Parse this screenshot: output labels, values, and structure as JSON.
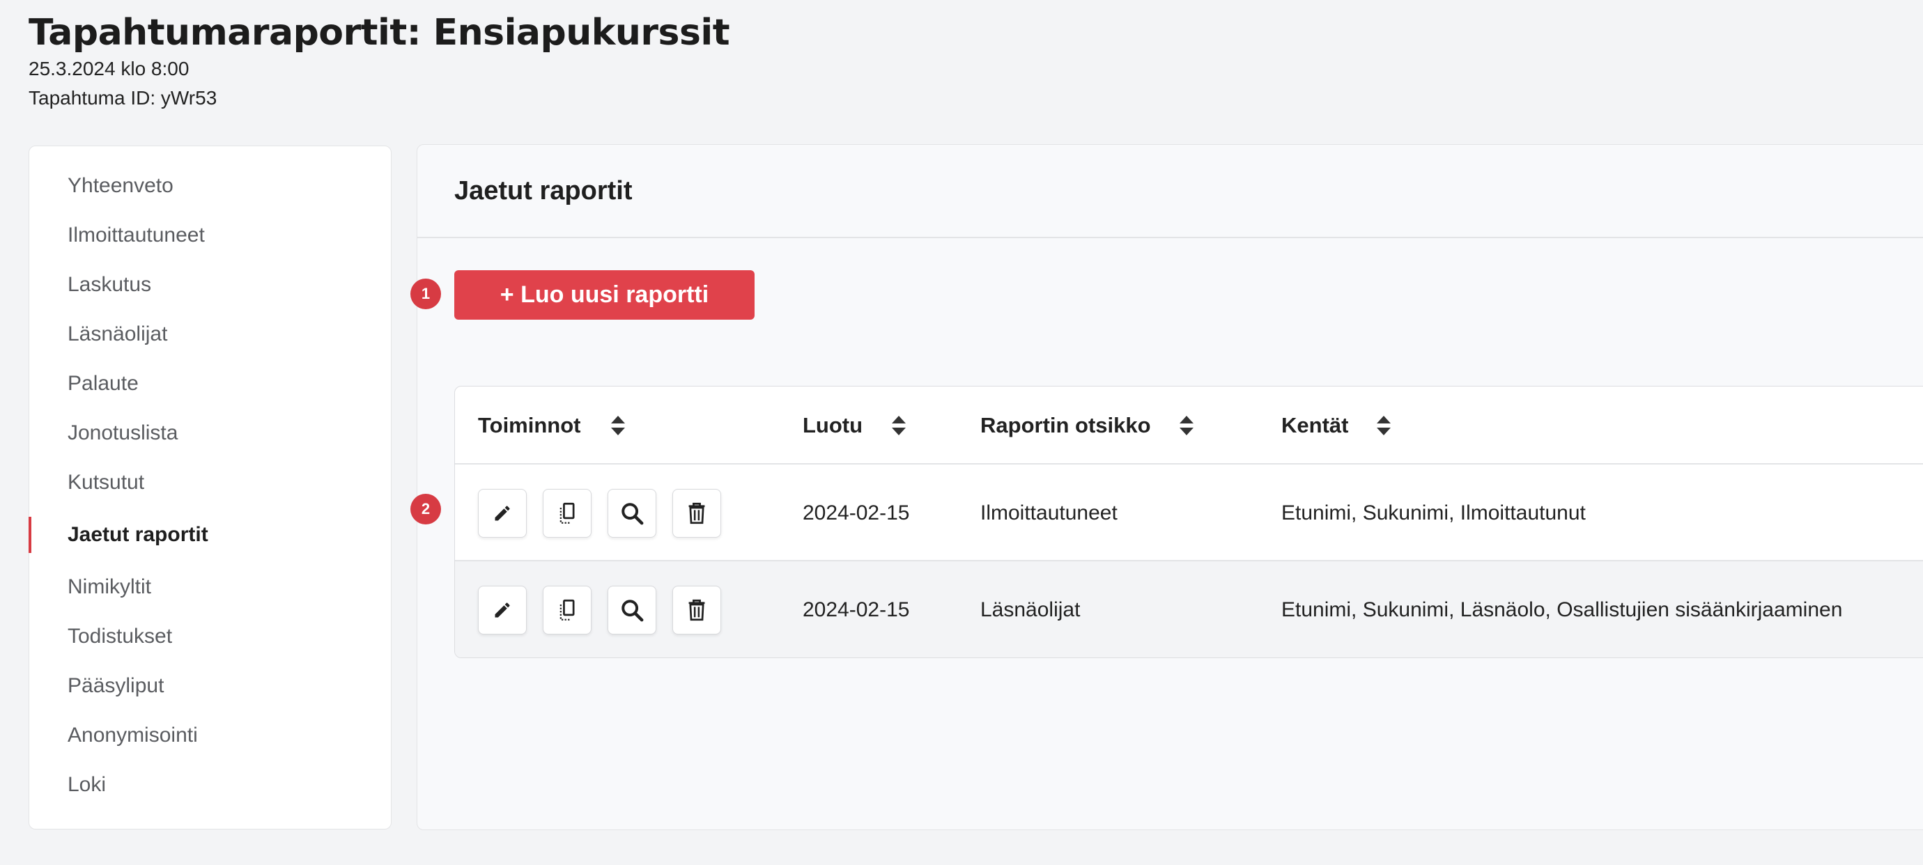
{
  "header": {
    "title": "Tapahtumaraportit: Ensiapukurssit",
    "datetime": "25.3.2024 klo 8:00",
    "event_id": "Tapahtuma ID: yWr53"
  },
  "sidebar": {
    "items": [
      {
        "label": "Yhteenveto"
      },
      {
        "label": "Ilmoittautuneet"
      },
      {
        "label": "Laskutus"
      },
      {
        "label": "Läsnäolijat"
      },
      {
        "label": "Palaute"
      },
      {
        "label": "Jonotuslista"
      },
      {
        "label": "Kutsutut"
      },
      {
        "label": "Jaetut raportit",
        "active": true
      },
      {
        "label": "Nimikyltit"
      },
      {
        "label": "Todistukset"
      },
      {
        "label": "Pääsyliput"
      },
      {
        "label": "Anonymisointi"
      },
      {
        "label": "Loki"
      }
    ]
  },
  "main": {
    "title": "Jaetut raportit",
    "new_report_label": "+ Luo uusi raportti",
    "steps": [
      "1",
      "2"
    ]
  },
  "table": {
    "columns": [
      "Toiminnot",
      "Luotu",
      "Raportin otsikko",
      "Kentät"
    ],
    "rows": [
      {
        "created": "2024-02-15",
        "title": "Ilmoittautuneet",
        "fields": "Etunimi, Sukunimi, Ilmoittautunut"
      },
      {
        "created": "2024-02-15",
        "title": "Läsnäolijat",
        "fields": "Etunimi, Sukunimi, Läsnäolo, Osallistujien sisäänkirjaaminen"
      }
    ],
    "action_icons": [
      "pencil-icon",
      "copy-icon",
      "search-icon",
      "trash-icon"
    ]
  },
  "colors": {
    "accent": "#e0424b",
    "badge": "#d73b43",
    "background": "#f3f4f6"
  }
}
